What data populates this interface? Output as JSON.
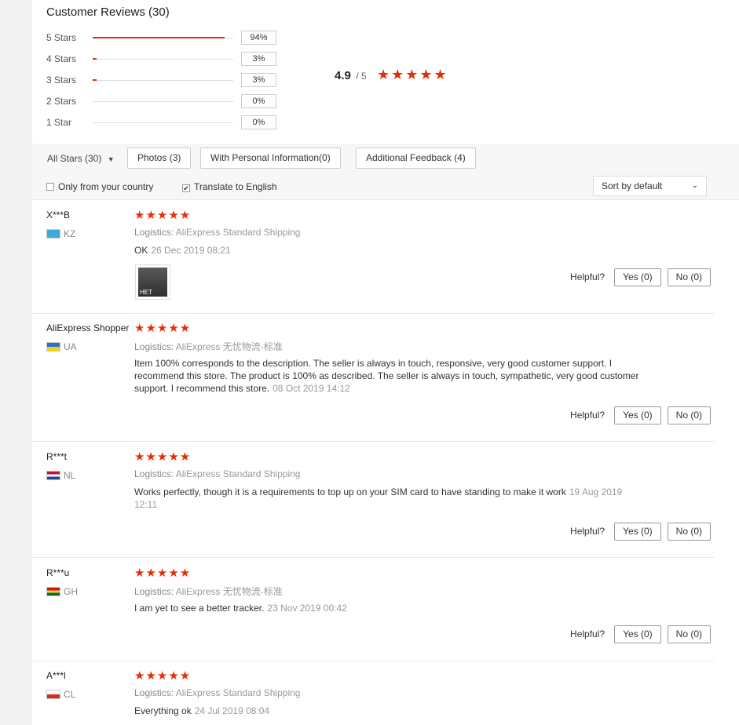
{
  "header": {
    "title": "Customer Reviews (30)"
  },
  "ratings": [
    {
      "label": "5 Stars",
      "percent": "94%",
      "fraction": 0.94
    },
    {
      "label": "4 Stars",
      "percent": "3%",
      "fraction": 0.03
    },
    {
      "label": "3 Stars",
      "percent": "3%",
      "fraction": 0.03
    },
    {
      "label": "2 Stars",
      "percent": "0%",
      "fraction": 0
    },
    {
      "label": "1 Star",
      "percent": "0%",
      "fraction": 0
    }
  ],
  "summary": {
    "score": "4.9",
    "out_of": "/ 5",
    "stars": "★★★★★"
  },
  "filters": {
    "all_stars": "All Stars (30)",
    "photos": "Photos (3)",
    "personal": "With Personal Information(0)",
    "additional": "Additional Feedback (4)",
    "only_country": "Only from your country",
    "translate": "Translate to English",
    "sort": "Sort by default"
  },
  "helpful": {
    "label": "Helpful?"
  },
  "reviews": [
    {
      "user": "X***B",
      "country": "KZ",
      "stars": "★★★★★",
      "logistics_label": "Logistics:",
      "logistics": "AliExpress Standard Shipping",
      "text": "OK",
      "date": "26 Dec 2019 08:21",
      "photo_caption": "НЕТ",
      "yes": "Yes (0)",
      "no": "No (0)"
    },
    {
      "user": "AliExpress Shopper",
      "country": "UA",
      "stars": "★★★★★",
      "logistics_label": "Logistics:",
      "logistics": "AliExpress 无忧物流-标准",
      "text": "Item 100% corresponds to the description. The seller is always in touch, responsive, very good customer support. I recommend this store. The product is 100% as described. The seller is always in touch, sympathetic, very good customer support. I recommend this store.",
      "date": "08 Oct 2019 14:12",
      "yes": "Yes (0)",
      "no": "No (0)"
    },
    {
      "user": "R***t",
      "country": "NL",
      "stars": "★★★★★",
      "logistics_label": "Logistics:",
      "logistics": "AliExpress Standard Shipping",
      "text": "Works perfectly, though it is a requirements to top up on your SIM card to have standing to make it work",
      "date": "19 Aug 2019 12:11",
      "yes": "Yes (0)",
      "no": "No (0)"
    },
    {
      "user": "R***u",
      "country": "GH",
      "stars": "★★★★★",
      "logistics_label": "Logistics:",
      "logistics": "AliExpress 无忧物流-标准",
      "text": "I am yet to see a better tracker.",
      "date": "23 Nov 2019 00:42",
      "yes": "Yes (0)",
      "no": "No (0)"
    },
    {
      "user": "A***l",
      "country": "CL",
      "stars": "★★★★★",
      "logistics_label": "Logistics:",
      "logistics": "AliExpress Standard Shipping",
      "text": "Everything ok",
      "date": "24 Jul 2019 08:04"
    }
  ],
  "colors": {
    "accent": "#e62e04",
    "muted": "#999999",
    "border": "#cccccc"
  }
}
